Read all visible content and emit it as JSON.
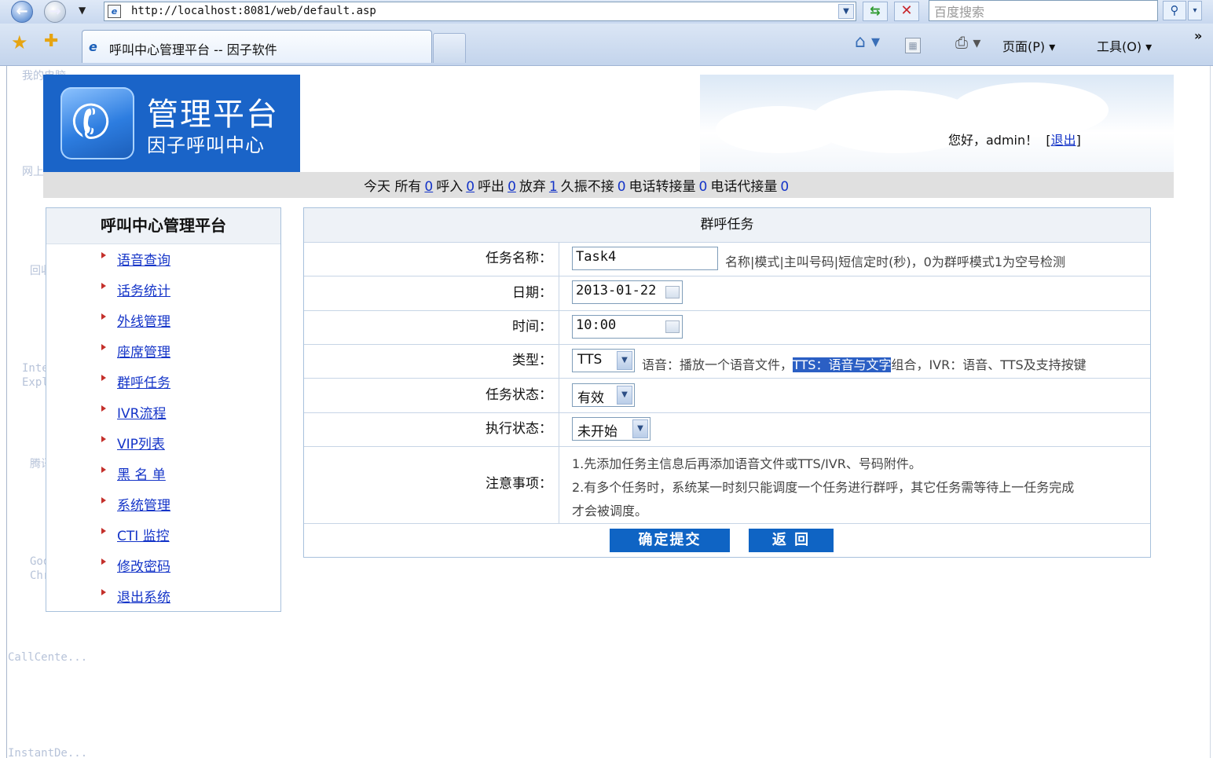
{
  "browser": {
    "url": "http://localhost:8081/web/default.asp",
    "search_placeholder": "百度搜索",
    "tab_title": "呼叫中心管理平台 -- 因子软件",
    "page_menu": "页面(P) ▾",
    "tools_menu": "工具(O) ▾"
  },
  "desktop_ghosts": [
    "我的电脑",
    "网上邻居",
    "回收站",
    "Internet",
    "Explorer",
    "腾讯QQ",
    "Google",
    "Chrome",
    "CallCente...",
    "InstantDe..."
  ],
  "header": {
    "logo_title": "管理平台",
    "logo_subtitle": "因子呼叫中心",
    "greeting": "您好，admin！",
    "logout": "退出"
  },
  "stats": {
    "today": "今天",
    "all_label": "所有",
    "all": "0",
    "in_label": "呼入",
    "in": "0",
    "out_label": "呼出",
    "out": "0",
    "abandon_label": "放弃",
    "abandon": "1",
    "noanswer_label": "久振不接",
    "noanswer": "0",
    "transfer_label": "电话转接量",
    "transfer": "0",
    "pickup_label": "电话代接量",
    "pickup": "0"
  },
  "menu": {
    "title": "呼叫中心管理平台",
    "items": [
      "语音查询",
      "话务统计",
      "外线管理",
      "座席管理",
      "群呼任务",
      "IVR流程",
      "VIP列表",
      "黑 名 单",
      "系统管理",
      "CTI 监控",
      "修改密码",
      "退出系统"
    ]
  },
  "form": {
    "title": "群呼任务",
    "task_name_label": "任务名称：",
    "task_name_value": "Task4",
    "task_name_hint": "名称|模式|主叫号码|短信定时(秒)，0为群呼模式1为空号检测",
    "date_label": "日期：",
    "date_value": "2013-01-22",
    "time_label": "时间：",
    "time_value": "10:00",
    "type_label": "类型：",
    "type_value": "TTS",
    "type_hint_a": "语音：播放一个语音文件，",
    "type_hint_hl": "TTS：语音与文字",
    "type_hint_b": "组合，IVR：语音、TTS及支持按键",
    "status_label": "任务状态：",
    "status_value": "有效",
    "exec_label": "执行状态：",
    "exec_value": "未开始",
    "notes_label": "注意事项：",
    "note1": "1.先添加任务主信息后再添加语音文件或TTS/IVR、号码附件。",
    "note2": "2.有多个任务时，系统某一时刻只能调度一个任务进行群呼，其它任务需等待上一任务完成",
    "note3": "才会被调度。",
    "submit": "确定提交",
    "back": "返 回"
  }
}
